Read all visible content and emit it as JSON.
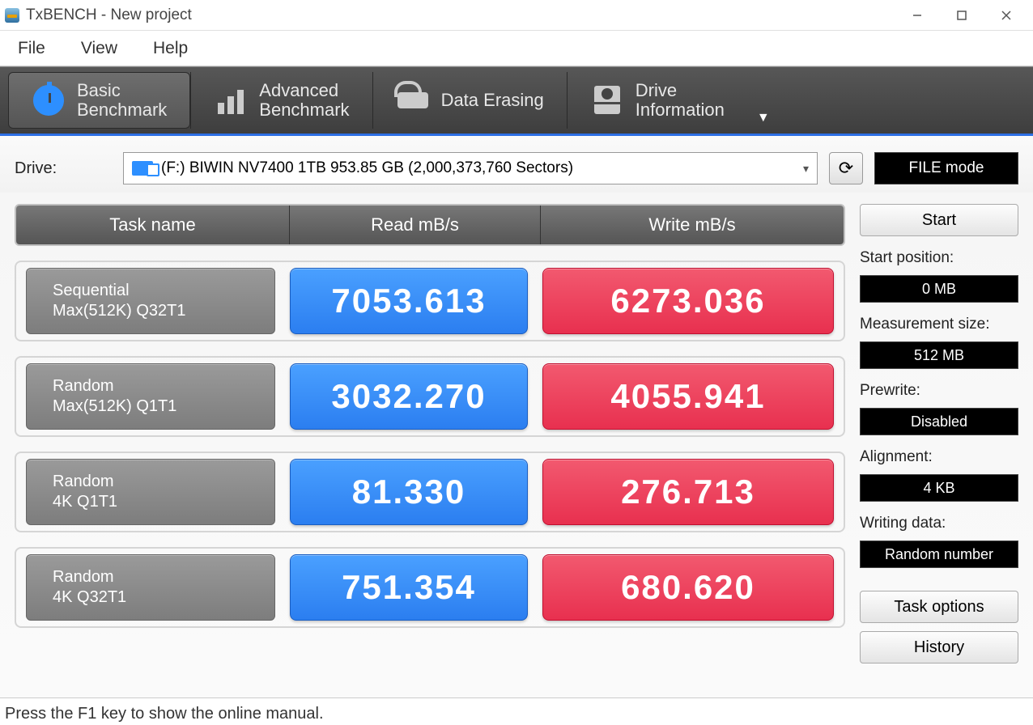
{
  "window": {
    "title": "TxBENCH - New project"
  },
  "menu": {
    "file": "File",
    "view": "View",
    "help": "Help"
  },
  "tabs": {
    "basic": {
      "l1": "Basic",
      "l2": "Benchmark"
    },
    "advanced": {
      "l1": "Advanced",
      "l2": "Benchmark"
    },
    "erase": {
      "l1": "Data Erasing"
    },
    "drive": {
      "l1": "Drive",
      "l2": "Information"
    }
  },
  "drive": {
    "label": "Drive:",
    "value": "(F:) BIWIN NV7400 1TB  953.85 GB (2,000,373,760 Sectors)",
    "file_mode": "FILE mode"
  },
  "headers": {
    "task": "Task name",
    "read": "Read mB/s",
    "write": "Write mB/s"
  },
  "rows": [
    {
      "name_l1": "Sequential",
      "name_l2": "Max(512K) Q32T1",
      "read": "7053.613",
      "write": "6273.036"
    },
    {
      "name_l1": "Random",
      "name_l2": "Max(512K) Q1T1",
      "read": "3032.270",
      "write": "4055.941"
    },
    {
      "name_l1": "Random",
      "name_l2": "4K Q1T1",
      "read": "81.330",
      "write": "276.713"
    },
    {
      "name_l1": "Random",
      "name_l2": "4K Q32T1",
      "read": "751.354",
      "write": "680.620"
    }
  ],
  "side": {
    "start": "Start",
    "start_pos_label": "Start position:",
    "start_pos_value": "0 MB",
    "meas_label": "Measurement size:",
    "meas_value": "512 MB",
    "prewrite_label": "Prewrite:",
    "prewrite_value": "Disabled",
    "align_label": "Alignment:",
    "align_value": "4 KB",
    "writing_label": "Writing data:",
    "writing_value": "Random number",
    "task_options": "Task options",
    "history": "History"
  },
  "status": "Press the F1 key to show the online manual."
}
